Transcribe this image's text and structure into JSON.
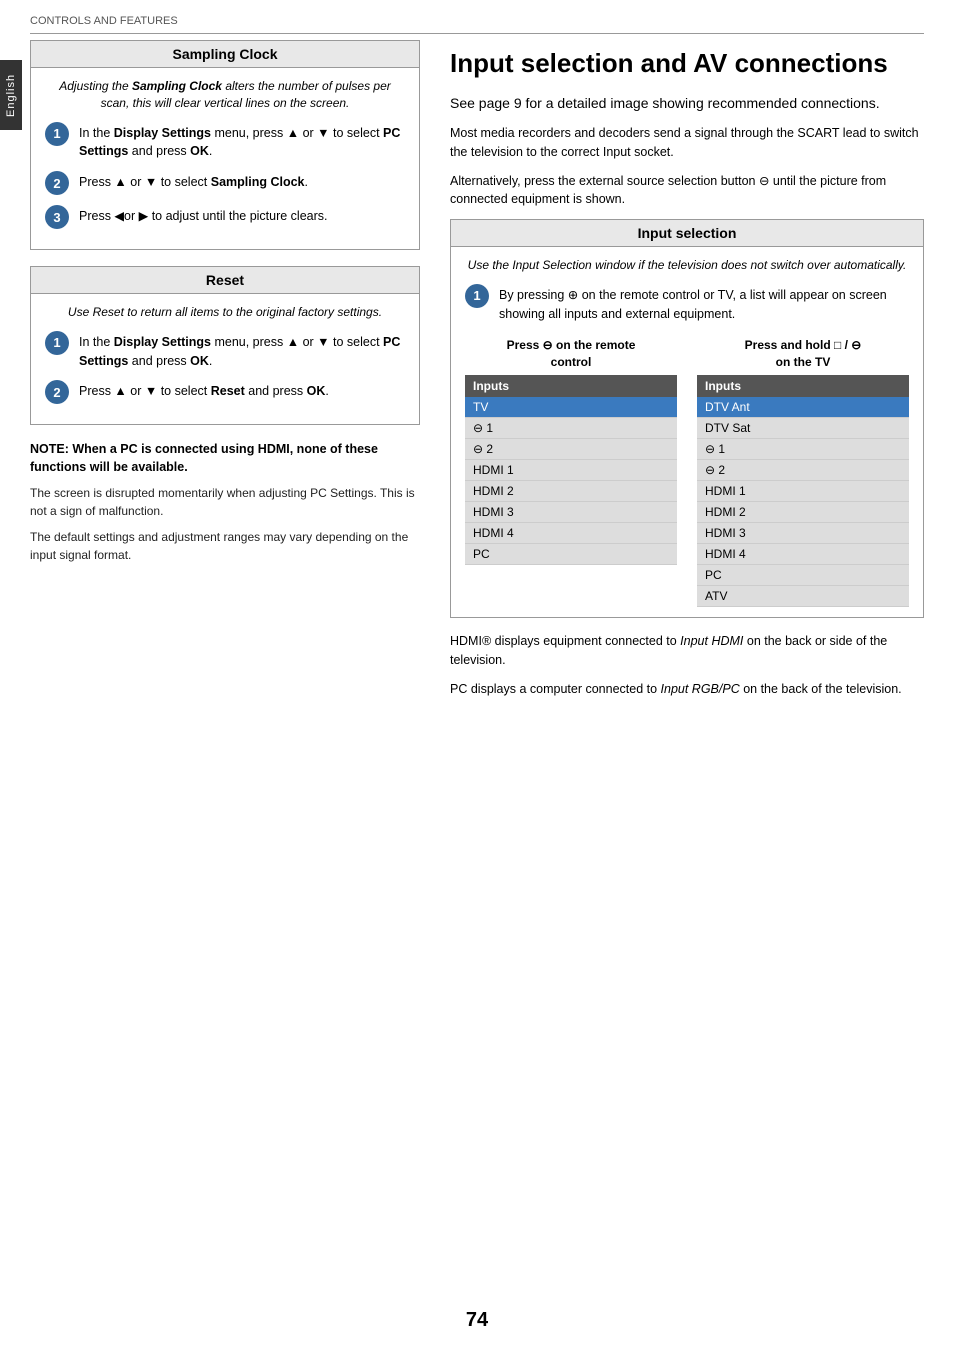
{
  "breadcrumb": "CONTROLS AND FEATURES",
  "side_label": "English",
  "page_number": "74",
  "left_col": {
    "sampling_clock": {
      "title": "Sampling Clock",
      "italic_note": "Adjusting the Sampling Clock alters the number of pulses per scan, this will clear vertical lines on the screen.",
      "steps": [
        {
          "num": "1",
          "text_parts": [
            "In the ",
            "Display Settings",
            " menu, press ",
            "▲",
            " or ",
            "▼",
            " to select ",
            "PC Settings",
            " and press ",
            "OK",
            "."
          ]
        },
        {
          "num": "2",
          "text_parts": [
            "Press ",
            "▲",
            " or ",
            "▼",
            " to select ",
            "Sampling Clock",
            "."
          ]
        },
        {
          "num": "3",
          "text_parts": [
            "Press ",
            "◀",
            "or ",
            "▶",
            " to adjust until the picture clears."
          ]
        }
      ]
    },
    "reset": {
      "title": "Reset",
      "italic_note": "Use Reset to return all items to the original factory settings.",
      "steps": [
        {
          "num": "1",
          "text_parts": [
            "In the ",
            "Display Settings",
            " menu, press ",
            "▲",
            " or ",
            "▼",
            " to select ",
            "PC Settings",
            " and press ",
            "OK",
            "."
          ]
        },
        {
          "num": "2",
          "text_parts": [
            "Press ",
            "▲",
            " or ",
            "▼",
            " to select ",
            "Reset",
            " and press ",
            "OK",
            "."
          ]
        }
      ]
    },
    "note": {
      "bold": "NOTE: When a PC is connected using HDMI, none of these functions will be available.",
      "paragraphs": [
        "The screen is disrupted momentarily when adjusting PC Settings. This is not a sign of malfunction.",
        "The default settings and adjustment ranges may vary depending on the input signal format."
      ]
    }
  },
  "right_col": {
    "big_title": "Input selection and AV connections",
    "intro": "See page 9 for a detailed image showing recommended connections.",
    "body1": "Most media recorders and decoders send a signal through the SCART lead to switch the television to the correct Input socket.",
    "body2": "Alternatively, press the external source selection button ⊕ until the picture from connected equipment is shown.",
    "input_selection": {
      "title": "Input selection",
      "italic_note": "Use the Input Selection window if the television does not switch over automatically.",
      "step1_text": "By pressing ⊕ on the remote control or TV, a list will appear on screen showing all inputs and external equipment.",
      "table_left": {
        "header": "Press ⊕ on the remote control",
        "col_header": "Inputs",
        "rows": [
          {
            "label": "TV",
            "highlighted": true
          },
          {
            "label": "⊕ 1",
            "highlighted": false
          },
          {
            "label": "⊕ 2",
            "highlighted": false
          },
          {
            "label": "HDMI 1",
            "highlighted": false
          },
          {
            "label": "HDMI 2",
            "highlighted": false
          },
          {
            "label": "HDMI 3",
            "highlighted": false
          },
          {
            "label": "HDMI 4",
            "highlighted": false
          },
          {
            "label": "PC",
            "highlighted": false
          }
        ]
      },
      "table_right": {
        "header": "Press and hold ⊡ / ⊕ on the TV",
        "col_header": "Inputs",
        "rows": [
          {
            "label": "DTV Ant",
            "highlighted": true
          },
          {
            "label": "DTV Sat",
            "highlighted": false
          },
          {
            "label": "⊕ 1",
            "highlighted": false
          },
          {
            "label": "⊕ 2",
            "highlighted": false
          },
          {
            "label": "HDMI 1",
            "highlighted": false
          },
          {
            "label": "HDMI 2",
            "highlighted": false
          },
          {
            "label": "HDMI 3",
            "highlighted": false
          },
          {
            "label": "HDMI 4",
            "highlighted": false
          },
          {
            "label": "PC",
            "highlighted": false
          },
          {
            "label": "ATV",
            "highlighted": false
          }
        ]
      }
    },
    "footer1": "HDMI® displays equipment connected to Input HDMI on the back or side of the television.",
    "footer2": "PC displays a computer connected to Input RGB/PC on the back of the television."
  }
}
